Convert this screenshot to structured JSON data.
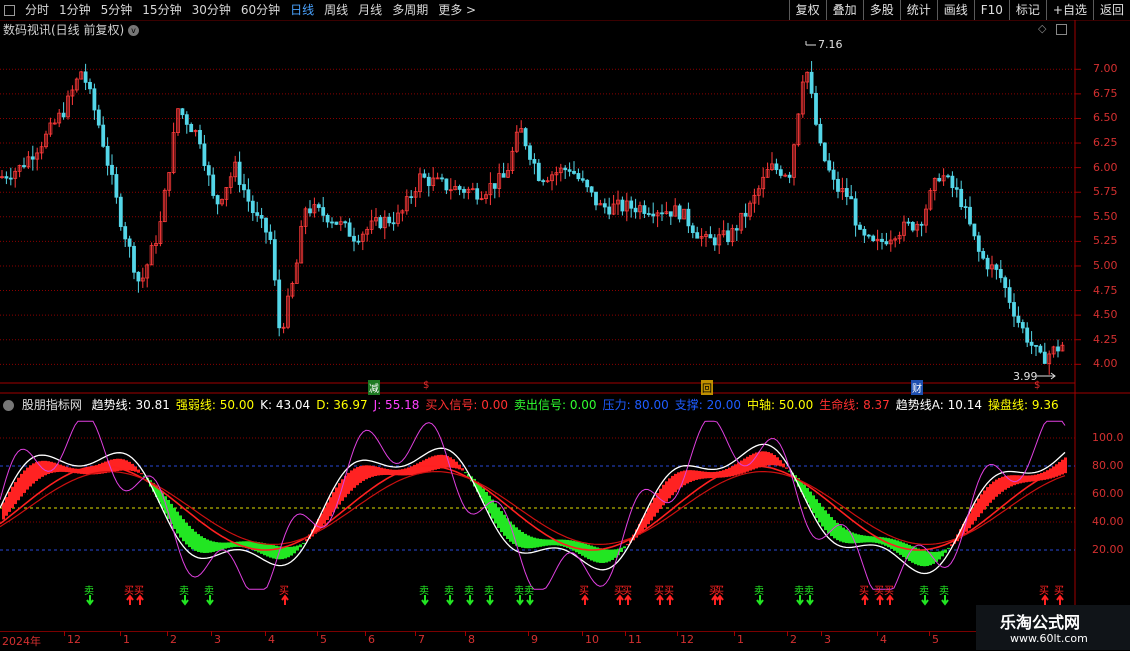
{
  "toolbar": {
    "tabs": [
      "分时",
      "1分钟",
      "5分钟",
      "15分钟",
      "30分钟",
      "60分钟",
      "日线",
      "周线",
      "月线",
      "多周期",
      "更多 >"
    ],
    "active_tab": "日线",
    "buttons": [
      "复权",
      "叠加",
      "多股",
      "统计",
      "画线",
      "F10",
      "标记",
      "+自选",
      "返回"
    ]
  },
  "main_chart": {
    "title": "数码视讯(日线 前复权)",
    "high_label": "7.16",
    "low_label": "3.99",
    "y_ticks": [
      "7.00",
      "6.75",
      "6.50",
      "6.25",
      "6.00",
      "5.75",
      "5.50",
      "5.25",
      "5.00",
      "4.75",
      "4.50",
      "4.25",
      "4.00"
    ],
    "events": [
      {
        "text": "减",
        "color": "#2fb040"
      },
      {
        "text": "$",
        "color": "#e03030"
      },
      {
        "text": "回",
        "color": "#d8b000"
      },
      {
        "text": "财",
        "color": "#3070e0"
      },
      {
        "text": "$",
        "color": "#e03030"
      }
    ]
  },
  "indicator": {
    "name": "股朋指标网",
    "items": [
      {
        "label": "趋势线: 30.81",
        "color": "#ffffff"
      },
      {
        "label": "强弱线: 50.00",
        "color": "#ffff00"
      },
      {
        "label": "K: 43.04",
        "color": "#ffffff"
      },
      {
        "label": "D: 36.97",
        "color": "#ffff00"
      },
      {
        "label": "J: 55.18",
        "color": "#ff40ff"
      },
      {
        "label": "买入信号: 0.00",
        "color": "#ff3030"
      },
      {
        "label": "卖出信号: 0.00",
        "color": "#30ff30"
      },
      {
        "label": "压力: 80.00",
        "color": "#1e5cff"
      },
      {
        "label": "支撑: 20.00",
        "color": "#1e5cff"
      },
      {
        "label": "中轴: 50.00",
        "color": "#ffff00"
      },
      {
        "label": "生命线: 8.37",
        "color": "#ff3030"
      },
      {
        "label": "趋势线A: 10.14",
        "color": "#ffffff"
      },
      {
        "label": "操盘线: 9.36",
        "color": "#ffff00"
      }
    ],
    "y_ticks": [
      "100.0",
      "80.00",
      "60.00",
      "40.00",
      "20.00"
    ],
    "signal_words": {
      "buy": "买",
      "sell": "卖"
    }
  },
  "x_axis": {
    "labels": [
      "2024年",
      "12",
      "1",
      "2",
      "3",
      "4",
      "5",
      "6",
      "7",
      "8",
      "9",
      "10",
      "11",
      "12",
      "1",
      "2",
      "3",
      "4",
      "5"
    ]
  },
  "watermark": {
    "title": "乐淘公式网",
    "url": "www.60lt.com"
  },
  "colors": {
    "up": "#ff3a3a",
    "down": "#54d6e8",
    "grid": "#8a0000",
    "axis": "#a00000"
  }
}
